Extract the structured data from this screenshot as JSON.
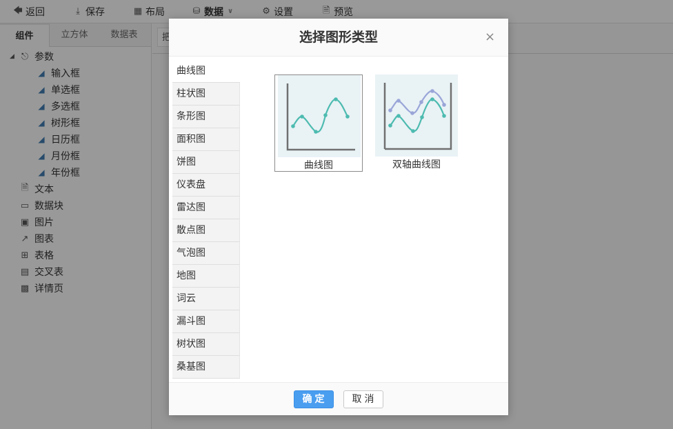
{
  "toolbar": {
    "back": "返回",
    "save": "保存",
    "layout": "布局",
    "data": "数据",
    "settings": "设置",
    "preview": "预览"
  },
  "left_panel": {
    "tabs": [
      "组件",
      "立方体",
      "数据表"
    ],
    "tree": {
      "params_label": "参数",
      "params_children": [
        "输入框",
        "单选框",
        "多选框",
        "树形框",
        "日历框",
        "月份框",
        "年份框"
      ],
      "items": [
        "文本",
        "数据块",
        "图片",
        "图表",
        "表格",
        "交叉表",
        "详情页"
      ]
    }
  },
  "right_tab_partial": "把",
  "dialog": {
    "title": "选择图形类型",
    "types": [
      "曲线图",
      "柱状图",
      "条形图",
      "面积图",
      "饼图",
      "仪表盘",
      "雷达图",
      "散点图",
      "气泡图",
      "地图",
      "词云",
      "漏斗图",
      "树状图",
      "桑基图"
    ],
    "active_type_index": 0,
    "charts": [
      {
        "label": "曲线图",
        "selected": true
      },
      {
        "label": "双轴曲线图",
        "selected": false
      }
    ],
    "ok_label": "确定",
    "cancel_label": "取消"
  },
  "colors": {
    "curve_teal": "#4dbbb0",
    "curve_lilac": "#9aa6d8",
    "thumb_bg": "#e9f2f5",
    "primary_button": "#4a9ef0",
    "tag_icon": "#3f79ad"
  }
}
